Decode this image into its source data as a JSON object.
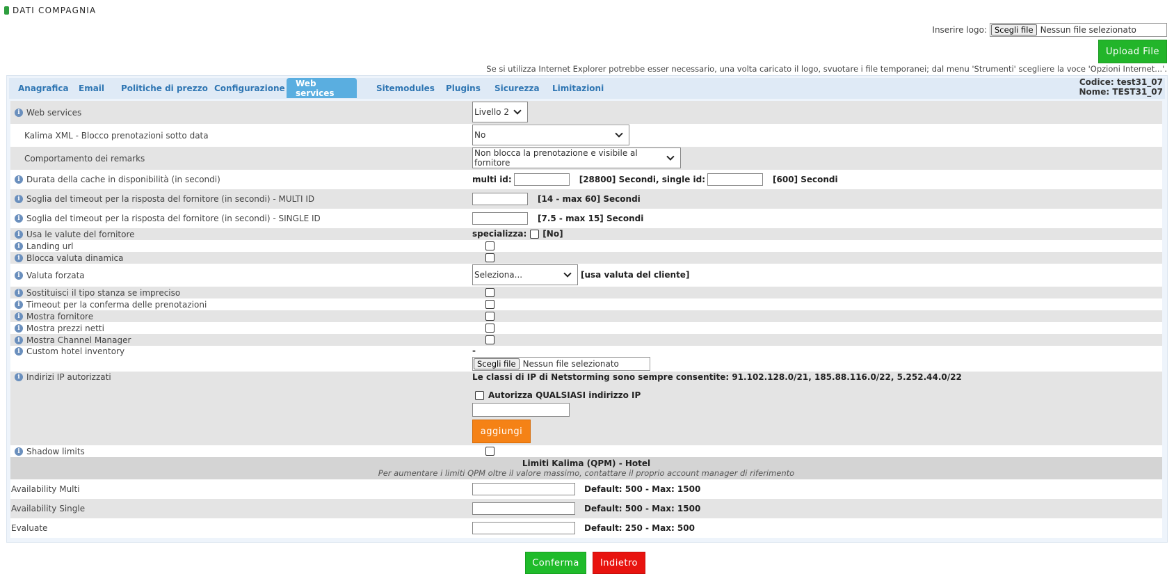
{
  "header": {
    "title": "DATI COMPAGNIA",
    "logo_label": "Inserire logo:",
    "choose_file": "Scegli file",
    "no_file": "Nessun file selezionato",
    "upload_label": "Upload File",
    "ie_note": "Se si utilizza Internet Explorer potrebbe esser necessario, una volta caricato il logo, svuotare i file temporanei; dal menu 'Strumenti' scegliere la voce 'Opzioni Internet...'."
  },
  "tabs": [
    {
      "label": "Anagrafica"
    },
    {
      "label": "Email"
    },
    {
      "label": "Politiche di prezzo"
    },
    {
      "label": "Configurazione"
    },
    {
      "label": "Web services",
      "active": true
    },
    {
      "label": "Sitemodules"
    },
    {
      "label": "Plugins"
    },
    {
      "label": "Sicurezza"
    },
    {
      "label": "Limitazioni"
    }
  ],
  "company": {
    "codice": "Codice: test31_07",
    "nome": "Nome: TEST31_07"
  },
  "rows": {
    "web_services": {
      "label": "Web services",
      "value": "Livello 2"
    },
    "kalima_xml": {
      "label": "Kalima XML - Blocco prenotazioni sotto data",
      "value": "No"
    },
    "remarks": {
      "label": "Comportamento dei remarks",
      "value": "Non blocca la prenotazione e visibile al fornitore"
    },
    "cache": {
      "label": "Durata della cache in disponibilità (in secondi)",
      "multi_label": "multi id:",
      "multi_hint": "[28800] Secondi, single id:",
      "single_hint": "[600] Secondi"
    },
    "timeout_multi": {
      "label": "Soglia del timeout per la risposta del fornitore (in secondi) - MULTI ID",
      "hint": "[14 - max 60] Secondi"
    },
    "timeout_single": {
      "label": "Soglia del timeout per la risposta del fornitore (in secondi) - SINGLE ID",
      "hint": "[7.5 - max 15] Secondi"
    },
    "valute_fornitore": {
      "label": "Usa le valute del fornitore",
      "spec_label": "specializza:",
      "spec_hint": "[No]"
    },
    "landing_url": {
      "label": "Landing url"
    },
    "valuta_dinamica": {
      "label": "Blocca valuta dinamica"
    },
    "valuta_forzata": {
      "label": "Valuta forzata",
      "value": "Seleziona...",
      "hint": "[usa valuta del cliente]"
    },
    "tipo_stanza": {
      "label": "Sostituisci il tipo stanza se impreciso"
    },
    "timeout_conferma": {
      "label": "Timeout per la conferma delle prenotazioni"
    },
    "mostra_fornitore": {
      "label": "Mostra fornitore"
    },
    "prezzi_netti": {
      "label": "Mostra prezzi netti"
    },
    "channel_manager": {
      "label": "Mostra Channel Manager"
    },
    "hotel_inventory": {
      "label": "Custom hotel inventory",
      "dash": "-",
      "choose_file": "Scegli file",
      "no_file": "Nessun file selezionato"
    },
    "ip": {
      "label": "Indirizi IP autorizzati",
      "note": "Le classi di IP di Netstorming sono sempre consentite: 91.102.128.0/21, 185.88.116.0/22, 5.252.44.0/22",
      "any_label": "Autorizza QUALSIASI indirizzo IP",
      "add_label": "aggiungi"
    },
    "shadow": {
      "label": "Shadow limits"
    }
  },
  "kalima": {
    "title": "Limiti Kalima (QPM) - Hotel",
    "subtitle": "Per aumentare i limiti QPM oltre il valore massimo, contattare il proprio account manager di riferimento",
    "items": [
      {
        "label": "Availability Multi",
        "hint": "Default: 500 - Max: 1500"
      },
      {
        "label": "Availability Single",
        "hint": "Default: 500 - Max: 1500"
      },
      {
        "label": "Evaluate",
        "hint": "Default: 250 - Max: 500"
      }
    ]
  },
  "actions": {
    "confirm": "Conferma",
    "back": "Indietro"
  }
}
